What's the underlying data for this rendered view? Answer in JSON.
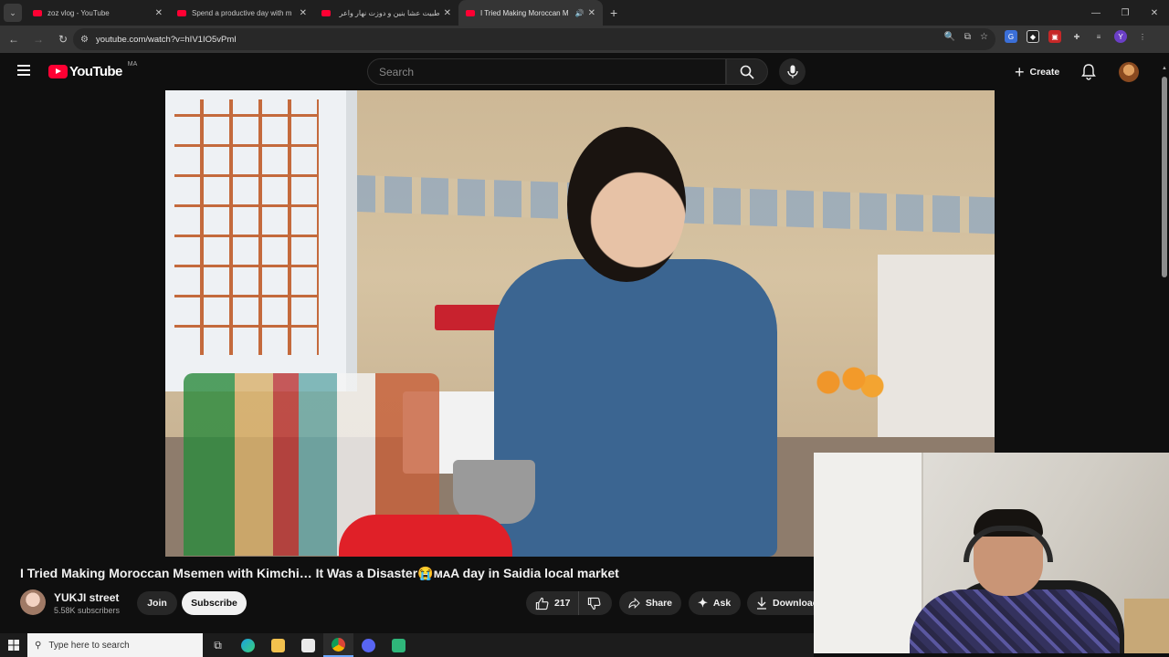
{
  "browser": {
    "tabs": [
      {
        "title": "zoz vlog - YouTube",
        "active": false,
        "audio": false
      },
      {
        "title": "Spend a productive day with m",
        "active": false,
        "audio": false
      },
      {
        "title": "طبيت عشا بنين و دوزت نهار واعر",
        "active": false,
        "audio": false
      },
      {
        "title": "I Tried Making Moroccan M",
        "active": true,
        "audio": true
      }
    ],
    "url": "youtube.com/watch?v=hIV1IO5vPmI",
    "profile_initial": "Y"
  },
  "youtube": {
    "logo_text": "YouTube",
    "region": "MA",
    "search_placeholder": "Search",
    "create_label": "Create"
  },
  "video": {
    "title": "I Tried Making Moroccan Msemen with Kimchi… It Was a Disaster😭ᴍᴀA day in Saidia local market",
    "channel_name": "YUKJI street",
    "subscribers": "5.58K subscribers",
    "join_label": "Join",
    "subscribe_label": "Subscribe",
    "likes": "217",
    "share_label": "Share",
    "ask_label": "Ask",
    "download_label": "Download"
  },
  "taskbar": {
    "search_placeholder": "Type here to search"
  },
  "colors": {
    "accent_red": "#ff0033",
    "background": "#0f0f0f",
    "chip": "#272727"
  }
}
